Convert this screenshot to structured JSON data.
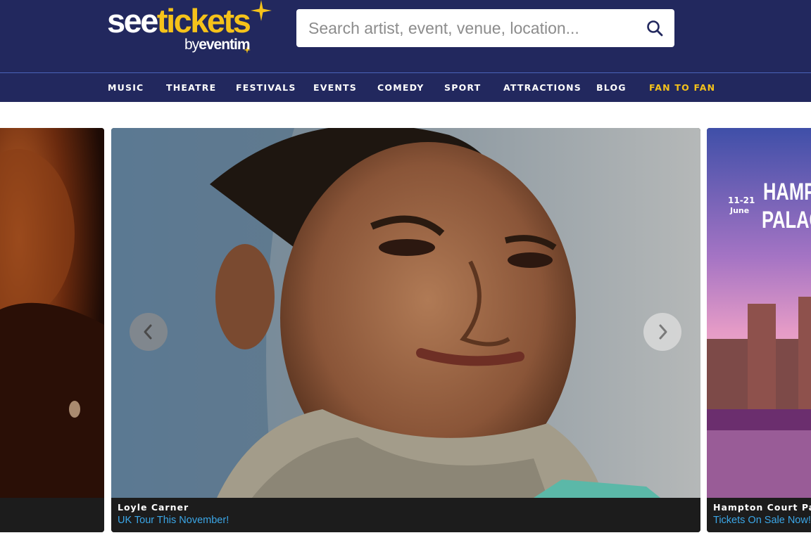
{
  "logo": {
    "see": "see",
    "tickets": "tickets",
    "by": "by",
    "eventim": "eventim"
  },
  "search": {
    "placeholder": "Search artist, event, venue, location...",
    "value": "",
    "icon": "search-icon"
  },
  "nav": {
    "items": [
      "MUSIC",
      "THEATRE",
      "FESTIVALS",
      "EVENTS",
      "COMEDY",
      "SPORT",
      "ATTRACTIONS",
      "BLOG"
    ],
    "accent_item": "FAN TO FAN",
    "accent_color": "#f5c21a"
  },
  "carousel": {
    "prev_icon": "chevron-left-icon",
    "next_icon": "chevron-right-icon",
    "main": {
      "title": "Loyle Carner",
      "subtitle": "UK Tour This November!"
    },
    "next": {
      "title": "Hampton Court Palac",
      "subtitle": "Tickets On Sale Now!",
      "poster_dates": "11-21",
      "poster_month": "June",
      "poster_text_1": "HAMPT",
      "poster_text_2": "PALAC"
    }
  },
  "colors": {
    "header_bg": "#22285e",
    "nav_border": "#4b63b8",
    "link": "#3ba6e6"
  }
}
